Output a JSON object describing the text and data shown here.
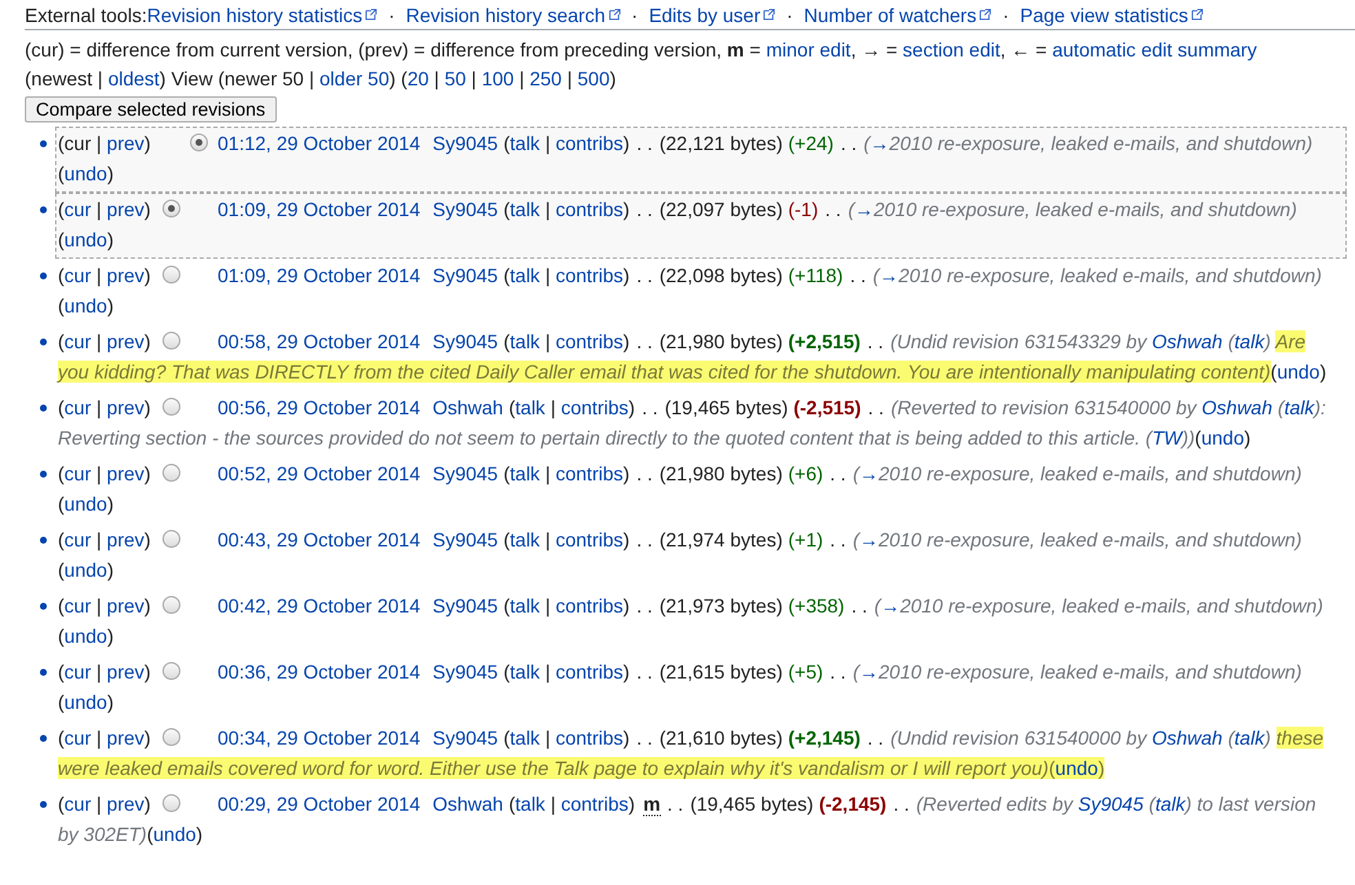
{
  "external_tools": {
    "label": "External tools:",
    "links": [
      "Revision history statistics",
      "Revision history search",
      "Edits by user",
      "Number of watchers",
      "Page view statistics"
    ],
    "sep": "·"
  },
  "legend": [
    {
      "text": "(cur) = difference from current version, (prev) = difference from preceding version, ",
      "kind": "plain"
    },
    {
      "text": "m",
      "kind": "bold"
    },
    {
      "text": " = ",
      "kind": "plain"
    },
    {
      "text": "minor edit",
      "kind": "link"
    },
    {
      "text": ", → = ",
      "kind": "plain"
    },
    {
      "text": "section edit",
      "kind": "link"
    },
    {
      "text": ", ← = ",
      "kind": "plain"
    },
    {
      "text": "automatic edit summary",
      "kind": "link"
    }
  ],
  "navigation": [
    {
      "text": "(newest | ",
      "kind": "plain"
    },
    {
      "text": "oldest",
      "kind": "link"
    },
    {
      "text": ") View (newer 50 | ",
      "kind": "plain"
    },
    {
      "text": "older 50",
      "kind": "link"
    },
    {
      "text": ") (",
      "kind": "plain"
    },
    {
      "text": "20",
      "kind": "link"
    },
    {
      "text": " | ",
      "kind": "plain"
    },
    {
      "text": "50",
      "kind": "link"
    },
    {
      "text": " | ",
      "kind": "plain"
    },
    {
      "text": "100",
      "kind": "link"
    },
    {
      "text": " | ",
      "kind": "plain"
    },
    {
      "text": "250",
      "kind": "link"
    },
    {
      "text": " | ",
      "kind": "plain"
    },
    {
      "text": "500",
      "kind": "link"
    },
    {
      "text": ")",
      "kind": "plain"
    }
  ],
  "compare_button": "Compare selected revisions",
  "punct": {
    "open": "(",
    "close": ")",
    "pipe": "|",
    "sep": ". ."
  },
  "rows": [
    {
      "selected": true,
      "cur": "cur",
      "cur_link": false,
      "prev": "prev",
      "radio": {
        "kind": "right",
        "selected": true
      },
      "time": "01:12, 29 October 2014",
      "user": "Sy9045",
      "talk": "talk",
      "contribs": "contribs",
      "bytes": "(22,121 bytes)",
      "diff": "(+24)",
      "increase": true,
      "large": false,
      "summary": [
        {
          "text": "(",
          "kind": "plain"
        },
        {
          "text": "→",
          "kind": "link"
        },
        {
          "text": "2010 re-exposure, leaked e-mails, and shutdown)",
          "kind": "plain"
        }
      ],
      "undo": "undo",
      "undo_marked": false
    },
    {
      "selected": true,
      "cur": "cur",
      "cur_link": true,
      "prev": "prev",
      "radio": {
        "kind": "left",
        "selected": true
      },
      "time": "01:09, 29 October 2014",
      "user": "Sy9045",
      "talk": "talk",
      "contribs": "contribs",
      "bytes": "(22,097 bytes)",
      "diff": "(-1)",
      "increase": false,
      "large": false,
      "summary": [
        {
          "text": "(",
          "kind": "plain"
        },
        {
          "text": "→",
          "kind": "link"
        },
        {
          "text": "2010 re-exposure, leaked e-mails, and shutdown)",
          "kind": "plain"
        }
      ],
      "undo": "undo",
      "undo_marked": false
    },
    {
      "selected": false,
      "cur": "cur",
      "cur_link": true,
      "prev": "prev",
      "radio": {
        "kind": "left",
        "selected": false
      },
      "time": "01:09, 29 October 2014",
      "user": "Sy9045",
      "talk": "talk",
      "contribs": "contribs",
      "bytes": "(22,098 bytes)",
      "diff": "(+118)",
      "increase": true,
      "large": false,
      "summary": [
        {
          "text": "(",
          "kind": "plain"
        },
        {
          "text": "→",
          "kind": "link"
        },
        {
          "text": "2010 re-exposure, leaked e-mails, and shutdown)",
          "kind": "plain"
        }
      ],
      "undo": "undo",
      "undo_marked": false
    },
    {
      "selected": false,
      "cur": "cur",
      "cur_link": true,
      "prev": "prev",
      "radio": {
        "kind": "left",
        "selected": false
      },
      "time": "00:58, 29 October 2014",
      "user": "Sy9045",
      "talk": "talk",
      "contribs": "contribs",
      "bytes": "(21,980 bytes)",
      "diff": "(+2,515)",
      "increase": true,
      "large": true,
      "summary": [
        {
          "text": "(Undid revision 631543329 by ",
          "kind": "plain"
        },
        {
          "text": "Oshwah",
          "kind": "link"
        },
        {
          "text": " (",
          "kind": "plain"
        },
        {
          "text": "talk",
          "kind": "link"
        },
        {
          "text": ") ",
          "kind": "plain"
        },
        {
          "text": "Are ",
          "kind": "marked"
        },
        {
          "text": "you kidding? That was DIRECTLY from the cited Daily Caller email that was cited for the shutdown. You are intentionally manipulating content)",
          "kind": "marked"
        }
      ],
      "undo": "undo",
      "undo_marked": false
    },
    {
      "selected": false,
      "cur": "cur",
      "cur_link": true,
      "prev": "prev",
      "radio": {
        "kind": "left",
        "selected": false
      },
      "time": "00:56, 29 October 2014",
      "user": "Oshwah",
      "talk": "talk",
      "contribs": "contribs",
      "bytes": "(19,465 bytes)",
      "diff": "(-2,515)",
      "increase": false,
      "large": true,
      "summary": [
        {
          "text": "(Reverted to revision 631540000 by ",
          "kind": "plain"
        },
        {
          "text": "Oshwah",
          "kind": "link"
        },
        {
          "text": " (",
          "kind": "plain"
        },
        {
          "text": "talk",
          "kind": "link"
        },
        {
          "text": "): ",
          "kind": "plain"
        },
        {
          "text": "Reverting section - the sources provided do not seem to pertain directly to the quoted content that is being added to this article. (",
          "kind": "plain"
        },
        {
          "text": "TW",
          "kind": "link"
        },
        {
          "text": "))",
          "kind": "plain"
        }
      ],
      "undo": "undo",
      "undo_marked": false
    },
    {
      "selected": false,
      "cur": "cur",
      "cur_link": true,
      "prev": "prev",
      "radio": {
        "kind": "left",
        "selected": false
      },
      "time": "00:52, 29 October 2014",
      "user": "Sy9045",
      "talk": "talk",
      "contribs": "contribs",
      "bytes": "(21,980 bytes)",
      "diff": "(+6)",
      "increase": true,
      "large": false,
      "summary": [
        {
          "text": "(",
          "kind": "plain"
        },
        {
          "text": "→",
          "kind": "link"
        },
        {
          "text": "2010 re-exposure, leaked e-mails, and shutdown)",
          "kind": "plain"
        }
      ],
      "undo": "undo",
      "undo_marked": false
    },
    {
      "selected": false,
      "cur": "cur",
      "cur_link": true,
      "prev": "prev",
      "radio": {
        "kind": "left",
        "selected": false
      },
      "time": "00:43, 29 October 2014",
      "user": "Sy9045",
      "talk": "talk",
      "contribs": "contribs",
      "bytes": "(21,974 bytes)",
      "diff": "(+1)",
      "increase": true,
      "large": false,
      "summary": [
        {
          "text": "(",
          "kind": "plain"
        },
        {
          "text": "→",
          "kind": "link"
        },
        {
          "text": "2010 re-exposure, leaked e-mails, and shutdown)",
          "kind": "plain"
        }
      ],
      "undo": "undo",
      "undo_marked": false
    },
    {
      "selected": false,
      "cur": "cur",
      "cur_link": true,
      "prev": "prev",
      "radio": {
        "kind": "left",
        "selected": false
      },
      "time": "00:42, 29 October 2014",
      "user": "Sy9045",
      "talk": "talk",
      "contribs": "contribs",
      "bytes": "(21,973 bytes)",
      "diff": "(+358)",
      "increase": true,
      "large": false,
      "summary": [
        {
          "text": "(",
          "kind": "plain"
        },
        {
          "text": "→",
          "kind": "link"
        },
        {
          "text": "2010 re-exposure, leaked e-mails, and shutdown)",
          "kind": "plain"
        }
      ],
      "undo": "undo",
      "undo_marked": false
    },
    {
      "selected": false,
      "cur": "cur",
      "cur_link": true,
      "prev": "prev",
      "radio": {
        "kind": "left",
        "selected": false
      },
      "time": "00:36, 29 October 2014",
      "user": "Sy9045",
      "talk": "talk",
      "contribs": "contribs",
      "bytes": "(21,615 bytes)",
      "diff": "(+5)",
      "increase": true,
      "large": false,
      "summary": [
        {
          "text": "(",
          "kind": "plain"
        },
        {
          "text": "→",
          "kind": "link"
        },
        {
          "text": "2010 re-exposure, leaked e-mails, and shutdown)",
          "kind": "plain"
        }
      ],
      "undo": "undo",
      "undo_marked": false
    },
    {
      "selected": false,
      "cur": "cur",
      "cur_link": true,
      "prev": "prev",
      "radio": {
        "kind": "left",
        "selected": false
      },
      "time": "00:34, 29 October 2014",
      "user": "Sy9045",
      "talk": "talk",
      "contribs": "contribs",
      "bytes": "(21,610 bytes)",
      "diff": "(+2,145)",
      "increase": true,
      "large": true,
      "summary": [
        {
          "text": "(Undid revision 631540000 by ",
          "kind": "plain"
        },
        {
          "text": "Oshwah",
          "kind": "link"
        },
        {
          "text": " (",
          "kind": "plain"
        },
        {
          "text": "talk",
          "kind": "link"
        },
        {
          "text": ") ",
          "kind": "plain"
        },
        {
          "text": "these ",
          "kind": "marked"
        },
        {
          "text": "were leaked emails covered word for word. Either use the Talk page to explain why it's vandalism or I will report you)",
          "kind": "marked"
        }
      ],
      "undo": "undo",
      "undo_marked": true
    },
    {
      "selected": false,
      "cur": "cur",
      "cur_link": true,
      "prev": "prev",
      "radio": {
        "kind": "left",
        "selected": false
      },
      "time": "00:29, 29 October 2014",
      "user": "Oshwah",
      "talk": "talk",
      "contribs": "contribs",
      "minor_flag": "m",
      "bytes": "(19,465 bytes)",
      "diff": "(-2,145)",
      "increase": false,
      "large": true,
      "summary": [
        {
          "text": "(Reverted edits by ",
          "kind": "plain"
        },
        {
          "text": "Sy9045",
          "kind": "link"
        },
        {
          "text": " (",
          "kind": "plain"
        },
        {
          "text": "talk",
          "kind": "link"
        },
        {
          "text": ") to last version ",
          "kind": "plain"
        },
        {
          "text": "by 302ET)",
          "kind": "plain"
        }
      ],
      "undo": "undo",
      "undo_marked": false
    }
  ]
}
